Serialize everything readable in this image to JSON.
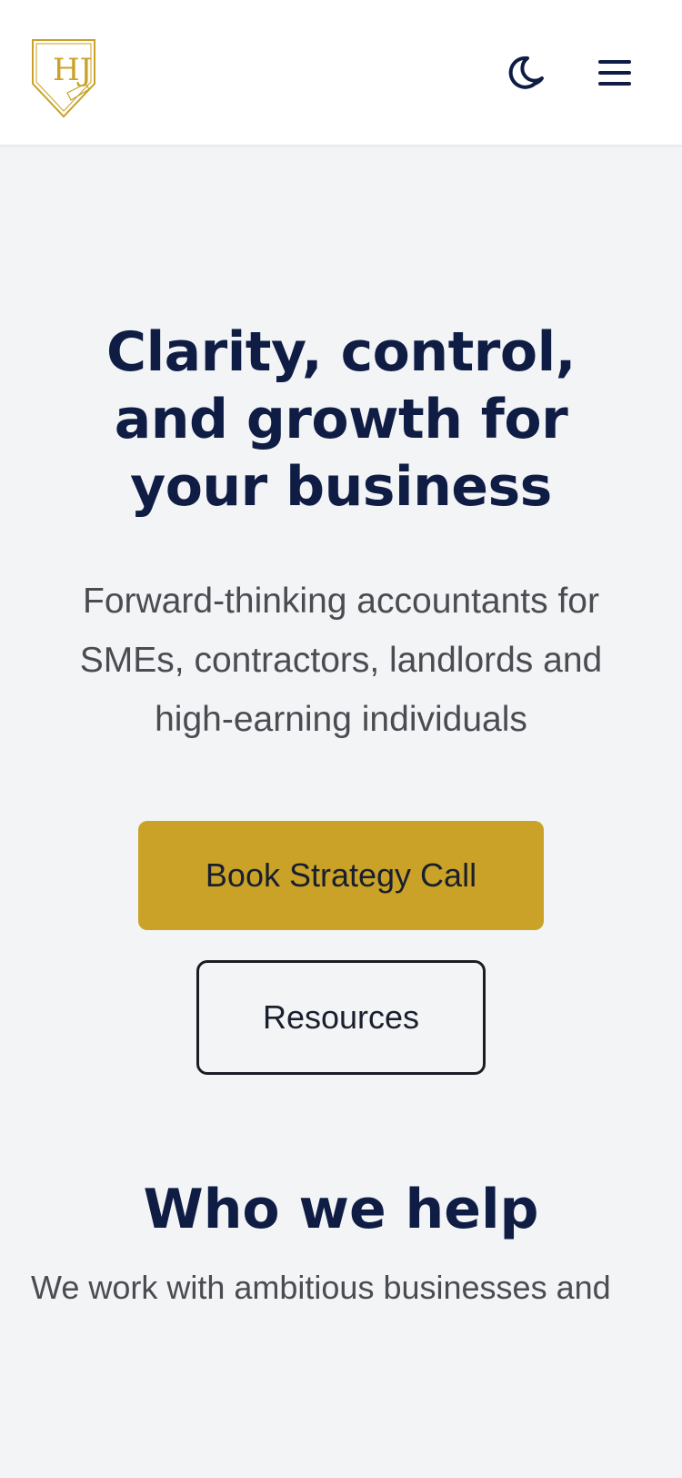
{
  "header": {
    "logo_alt": "HJ",
    "theme_toggle_icon": "moon-icon",
    "menu_icon": "hamburger-menu-icon"
  },
  "hero": {
    "title": "Clarity, control, and growth for your business",
    "subtitle": "Forward-thinking accountants for SMEs, contractors, landlords and high-earning individuals",
    "primary_cta": "Book Strategy Call",
    "secondary_cta": "Resources"
  },
  "who_we_help": {
    "title": "Who we help",
    "intro": "We work with ambitious businesses and"
  },
  "colors": {
    "brand_navy": "#0f1d45",
    "brand_gold": "#c9a227",
    "background": "#f3f4f6"
  }
}
